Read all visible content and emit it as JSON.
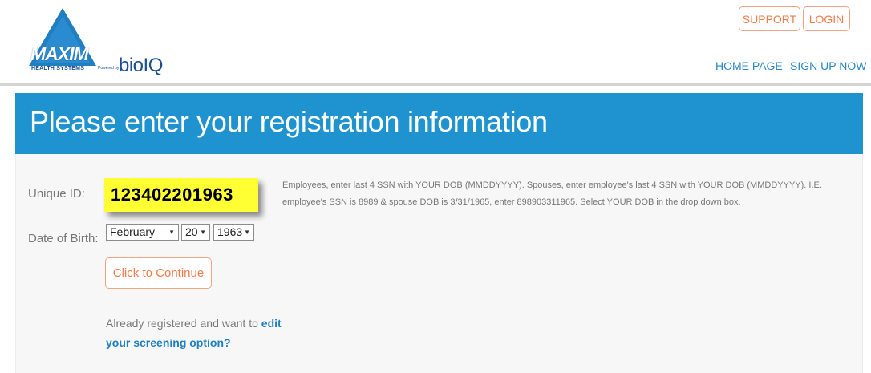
{
  "header": {
    "logo": {
      "brand": "MAXIM",
      "tagline": "HEALTH SYSTEMS",
      "powered_by": "Powered by",
      "partner": "bioIQ"
    },
    "buttons": {
      "support": "SUPPORT",
      "login": "LOGIN"
    },
    "nav": {
      "home": "HOME PAGE",
      "signup": "SIGN UP NOW"
    }
  },
  "banner": {
    "title": "Please enter your registration information"
  },
  "form": {
    "unique_id_label": "Unique ID:",
    "unique_id_value": "123402201963",
    "dob_label": "Date of Birth:",
    "dob": {
      "month": "February",
      "day": "20",
      "year": "1963"
    },
    "help_text": "Employees, enter last 4 SSN with YOUR DOB (MMDDYYYY). Spouses, enter employee's last 4 SSN with YOUR DOB (MMDDYYYY). I.E. employee's SSN is 8989 & spouse DOB is 3/31/1965, enter 898903311965. Select YOUR DOB in the drop down box.",
    "continue_button": "Click to Continue",
    "already_text": "Already registered and want to",
    "edit_link": "edit your screening option?"
  },
  "colors": {
    "banner": "#1f93d0",
    "accent_orange": "#f07c4c",
    "link_blue": "#2a87c4",
    "highlight": "#ffff33"
  }
}
